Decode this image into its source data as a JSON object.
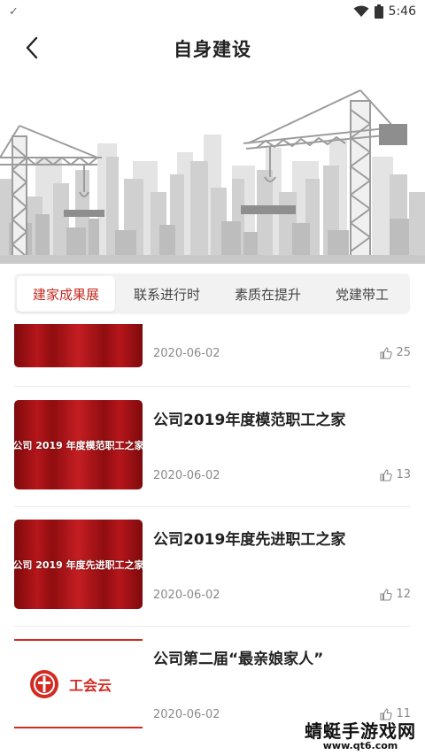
{
  "status_bar": {
    "check_icon": "check-icon",
    "wifi_icon": "wifi-icon",
    "battery_icon": "battery-icon",
    "time": "5:46"
  },
  "header": {
    "title": "自身建设",
    "back_icon": "chevron-left-icon"
  },
  "tabs": [
    {
      "label": "建家成果展",
      "active": true
    },
    {
      "label": "联系进行时",
      "active": false
    },
    {
      "label": "素质在提升",
      "active": false
    },
    {
      "label": "党建带工",
      "active": false
    }
  ],
  "articles": [
    {
      "title": "",
      "thumb_text": "",
      "date": "2020-06-02",
      "likes": "25"
    },
    {
      "title": "公司2019年度模范职工之家",
      "thumb_text": "公司 2019 年度模范职工之家",
      "date": "2020-06-02",
      "likes": "13"
    },
    {
      "title": "公司2019年度先进职工之家",
      "thumb_text": "公司 2019 年度先进职工之家",
      "date": "2020-06-02",
      "likes": "12"
    },
    {
      "title": "公司第二届“最亲娘家人”",
      "thumb_text": "工会云",
      "date": "2020-06-02",
      "likes": "11"
    }
  ],
  "watermark": {
    "line1": "蜻蜓手游戏网",
    "line2": "www.qt6.com"
  },
  "colors": {
    "accent": "#c62b20",
    "thumb_red": "#b5161b"
  }
}
